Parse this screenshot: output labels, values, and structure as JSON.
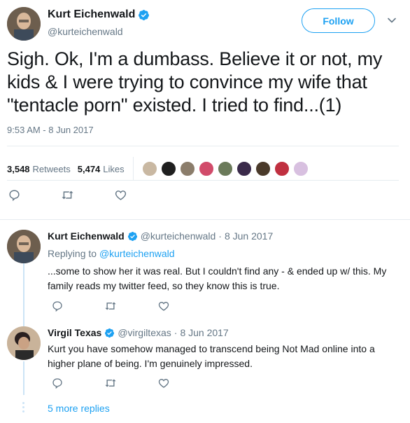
{
  "main_tweet": {
    "author_name": "Kurt Eichenwald",
    "author_handle": "@kurteichenwald",
    "follow_label": "Follow",
    "text": "Sigh. Ok, I'm a dumbass. Believe it or not, my kids & I were trying to convince my wife that \"tentacle porn\" existed. I tried to find...(1)",
    "timestamp": "9:53 AM - 8 Jun 2017",
    "retweets_count": "3,548",
    "retweets_label": "Retweets",
    "likes_count": "5,474",
    "likes_label": "Likes",
    "likers": [
      {
        "color": "#c9b8a2"
      },
      {
        "color": "#1f1f1f"
      },
      {
        "color": "#8b7d6b"
      },
      {
        "color": "#d14b6a"
      },
      {
        "color": "#6b7a5a"
      },
      {
        "color": "#3a2a4a"
      },
      {
        "color": "#4a3a2a"
      },
      {
        "color": "#c03040"
      },
      {
        "color": "#d8c0e0"
      }
    ]
  },
  "replies": [
    {
      "author_name": "Kurt Eichenwald",
      "author_handle": "@kurteichenwald",
      "date": "8 Jun 2017",
      "replying_prefix": "Replying to",
      "replying_handle": "@kurteichenwald",
      "text": "...some to show her it was real. But I couldn't find any - & ended up w/ this. My family reads my twitter feed, so they know this is true."
    },
    {
      "author_name": "Virgil Texas",
      "author_handle": "@virgiltexas",
      "date": "8 Jun 2017",
      "text": "Kurt you have somehow managed to transcend being Not Mad online into a higher plane of being. I'm genuinely impressed."
    }
  ],
  "more_replies_label": "5 more replies",
  "colors": {
    "accent": "#1da1f2",
    "muted": "#657786",
    "text": "#14171a",
    "thread": "#cce4f6"
  }
}
